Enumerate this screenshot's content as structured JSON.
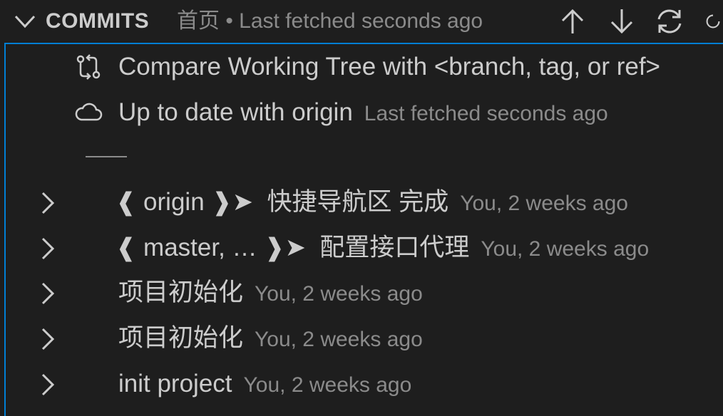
{
  "header": {
    "title": "COMMITS",
    "description": "首页 • Last fetched seconds ago",
    "actions": [
      "arrow-up-icon",
      "arrow-down-icon",
      "sync-icon",
      "refresh-icon"
    ]
  },
  "rows": {
    "compare": {
      "icon": "compare-changes-icon",
      "label": "Compare Working Tree with <branch, tag, or ref>"
    },
    "status": {
      "icon": "cloud-icon",
      "label": "Up to date with origin",
      "desc": "Last fetched seconds ago"
    },
    "separator": "——",
    "commits": [
      {
        "refs": "❰ origin ❱➤",
        "message": "快捷导航区 完成",
        "desc": "You, 2 weeks ago"
      },
      {
        "refs": "❰ master, … ❱➤",
        "message": "配置接口代理",
        "desc": "You, 2 weeks ago"
      },
      {
        "refs": "",
        "message": "项目初始化",
        "desc": "You, 2 weeks ago"
      },
      {
        "refs": "",
        "message": "项目初始化",
        "desc": "You, 2 weeks ago"
      },
      {
        "refs": "",
        "message": "init project",
        "desc": "You, 2 weeks ago"
      }
    ]
  },
  "colors": {
    "background": "#1e1e1e",
    "foreground": "#cccccc",
    "description": "#8b8b8b",
    "focus_border": "#007fd4"
  }
}
